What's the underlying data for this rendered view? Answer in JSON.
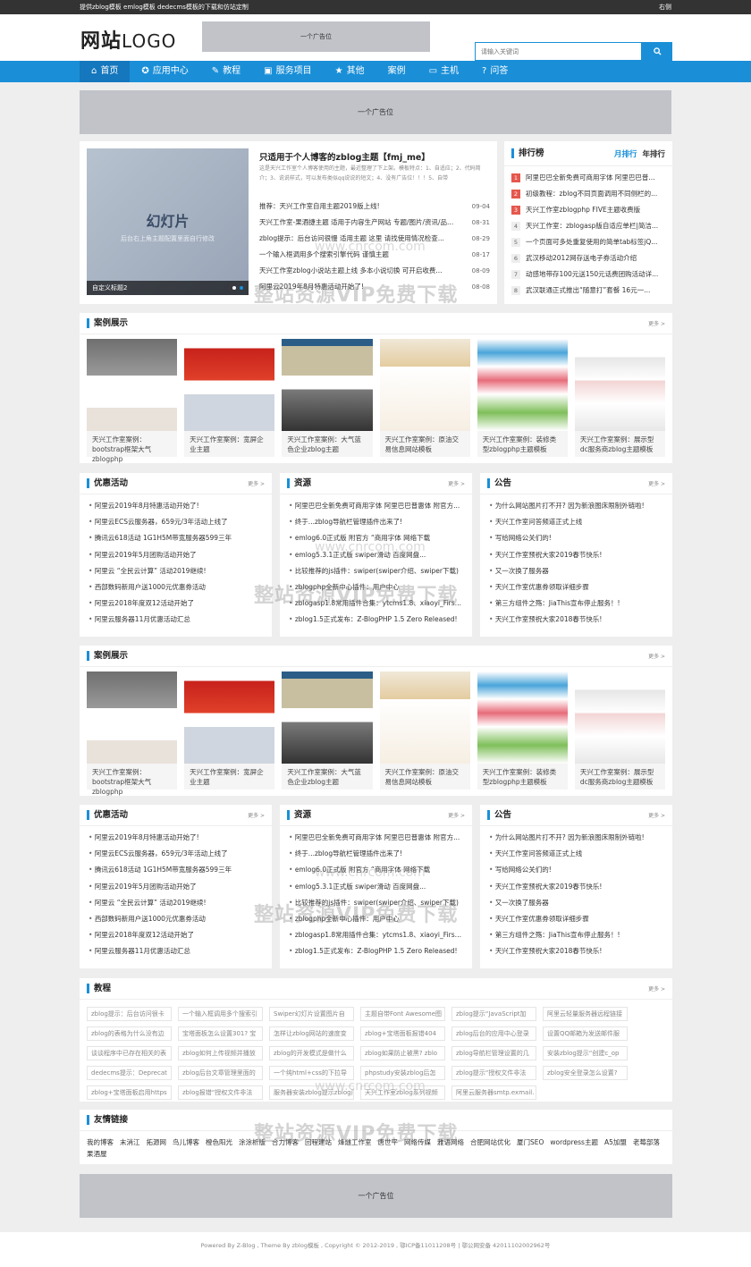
{
  "topbar": {
    "left": "提供zblog模板 emlog模板 dedecms模板的下载和仿站定制",
    "right": "右侧"
  },
  "header": {
    "logo_bold": "网站",
    "logo_rest": "LOGO",
    "ad": "一个广告位",
    "search_placeholder": "请输入关键词"
  },
  "nav": [
    {
      "label": "首页",
      "icon": "home-icon"
    },
    {
      "label": "应用中心",
      "icon": "gear-icon"
    },
    {
      "label": "教程",
      "icon": "wrench-icon"
    },
    {
      "label": "服务项目",
      "icon": "briefcase-icon"
    },
    {
      "label": "其他",
      "icon": "star-icon"
    },
    {
      "label": "案例",
      "icon": ""
    },
    {
      "label": "主机",
      "icon": "monitor-icon"
    },
    {
      "label": "问答",
      "icon": "question-icon"
    }
  ],
  "big_ad": "一个广告位",
  "bottom_ad": "一个广告位",
  "slider": {
    "title": "幻灯片",
    "subtitle": "后台右上角主题配置里面自行修改",
    "caption": "自定义标题2"
  },
  "featured": {
    "title": "只适用于个人博客的zblog主题【fmj_me】",
    "desc": "这是天兴工作室个人博客使用的主题，最近整理了下上架。模板特点：1、自适应；2、代码简介；3、说说样式，可以发布类似qq说说的短文；4、没有广告位！！！5、自带",
    "news": [
      {
        "t": "推荐：天兴工作室自用主题2019版上线!",
        "d": "09-04"
      },
      {
        "t": "天兴工作室-果酒捷主题 适用于内容生产网站 专题/图片/资讯/品...",
        "d": "08-31"
      },
      {
        "t": "zblog提示：后台访问很慢 适用主题 这里 请找使用情况检查...",
        "d": "08-29"
      },
      {
        "t": "一个输入框调用多个搜索引擎代码 谨慎主题",
        "d": "08-17"
      },
      {
        "t": "天兴工作室zblog小说站主题上线 多本小说切换 可开启收费...",
        "d": "08-09"
      },
      {
        "t": "阿里云2019年8月特惠活动开始了!",
        "d": "08-08"
      }
    ]
  },
  "rank": {
    "title": "排行榜",
    "tabs": [
      "月排行",
      "年排行"
    ],
    "items": [
      "阿里巴巴全新免费可商用字体 阿里巴巴普...",
      "初级教程：zblog不同页面调用不同侧栏的...",
      "天兴工作室zblogphp FIVE主题收费版",
      "天兴工作室：zblogasp版自适应单栏|简洁...",
      "一个页面可多处重复使用的简单tab标签jQ...",
      "武汉移动2012网存送电子券活动介绍",
      "动感地带存100元送150元话费团购活动详...",
      "武汉联通正式推出“随意打”套餐 16元一..."
    ]
  },
  "cases": {
    "title": "案例展示",
    "more": "更多 >",
    "items": [
      "天兴工作室案例：bootstrap框架大气zblogphp",
      "天兴工作室案例：宽屏企业主题",
      "天兴工作室案例：大气蓝色企业zblog主题",
      "天兴工作室案例：原油交易信息网站模板",
      "天兴工作室案例：装修类型zblogphp主题模板",
      "天兴工作室案例：展示型dc服务商zblog主题模板"
    ]
  },
  "promo": {
    "title": "优惠活动",
    "more": "更多 >",
    "items": [
      "阿里云2019年8月特惠活动开始了!",
      "阿里云ECS云服务器，659元/3年活动上线了",
      "腾讯云618活动 1G1H5M带宽服务器599三年",
      "阿里云2019年5月团购活动开始了",
      "阿里云 “全民云计算” 活动2019继续!",
      "西部数码新用户送1000元优惠券活动",
      "阿里云2018年度双12活动开始了",
      "阿里云服务器11月优惠活动汇总"
    ]
  },
  "resources": {
    "title": "资源",
    "more": "更多 >",
    "items": [
      "阿里巴巴全新免费可商用字体 阿里巴巴普惠体 附官方...",
      "终于...zblog导航栏管理插件出来了!",
      "emlog6.0正式版 附官方 “商用字体 网络下载",
      "emlog5.3.1正式版 swiper滑动 百度网盘...",
      "比较推荐的js插件：swiper(swiper介绍、swiper下载)",
      "zblogphp全新中心插件：用户中心",
      "zblogasp1.8常用插件合集：ytcms1.8、xiaoyi_FirstI...",
      "zblog1.5正式发布：Z-BlogPHP 1.5 Zero Released!"
    ]
  },
  "notice": {
    "title": "公告",
    "more": "更多 >",
    "items": [
      "为什么网站图片打不开? 因为新浪图床限制外链啦!",
      "天兴工作室问答频道正式上线",
      "写给网络公关们的!",
      "天兴工作室预祝大家2019春节快乐!",
      "又一次换了服务器",
      "天兴工作室优惠券领取详细步骤",
      "第三方组件之殇：JiaThis宣布停止服务！!",
      "天兴工作室预祝大家2018春节快乐!"
    ]
  },
  "tutorial": {
    "title": "教程",
    "more": "更多 >",
    "tags": [
      "zblog提示：后台访问很卡",
      "一个输入框调用多个搜索引",
      "Swiper幻灯片设置图片自",
      "主题自带Font Awesome图",
      "zblog提示“JavaScript加",
      "阿里云轻量服务器远程链接",
      "zblog的表格为什么没有边",
      "宝塔面板怎么设置301? 宝",
      "怎样让zblog网站的速度变",
      "zblog+宝塔面板报错404",
      "zblog后台的应用中心登录",
      "设置QQ邮箱为发送邮件服",
      "谈谈程序中已存在相关的表",
      "zblog如何上传视频并播放",
      "zblog的开发模式是做什么",
      "zblog如果防止被黑? zblo",
      "zblog导航栏管理设置的几",
      "安装zblog提示“创建c_op",
      "dedecms提示：Deprecat",
      "zblog后台文章管理里面的",
      "一个纯html+css的下拉导",
      "phpstudy安装zblog后怎",
      "zblog提示“授权文件非法",
      "zblog安全登录怎么设置?",
      "zblog+宝塔面板启用https",
      "zblog报错“授权文件非法",
      "服务器安装zblog提示zblog问题openssl_openssl_publ",
      "天兴工作室zblog系列视频",
      "阿里云服务器smtp.exmail."
    ]
  },
  "friends": {
    "title": "友情链接",
    "items": [
      "我的博客",
      "末消江",
      "拓源网",
      "鸟儿博客",
      "橙色阳光",
      "涂涂析版",
      "合力博客",
      "回程建站",
      "烽燧工作室",
      "唐世平",
      "网络传媒",
      "雅语网络",
      "合肥网站优化",
      "厦门SEO",
      "wordpress主题",
      "A5加盟",
      "老莓部落",
      "果酒屋"
    ]
  },
  "footer": "Powered By Z-Blog ,  Theme By zblog模板 , Copyright © 2012-2019 ,  鄂ICP备11011208号 | 鄂公网安备 42011102002962号",
  "watermark": {
    "text": "整站资源VIP免费下载",
    "url": "www.cnrcom.com"
  }
}
